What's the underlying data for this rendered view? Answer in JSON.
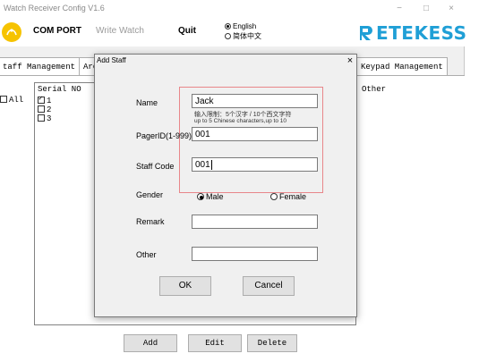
{
  "window": {
    "title": "Watch Receiver Config V1.6",
    "minimize": "−",
    "maximize": "□",
    "close": "×"
  },
  "toolbar": {
    "com_port": "COM PORT",
    "write_watch": "Write Watch",
    "quit": "Quit",
    "lang_english": "English",
    "lang_chinese": "简体中文",
    "selected_language": "English",
    "brand": "ETEKESS",
    "brand_color": "#1f9fd6"
  },
  "tabs": [
    {
      "label": "taff Management"
    },
    {
      "label": "Are"
    },
    {
      "label": "Keypad Management"
    }
  ],
  "staff_list": {
    "all_label": "All",
    "col_serial": "Serial NO",
    "col_other": "Other",
    "rows": [
      {
        "label": "1",
        "checked": true
      },
      {
        "label": "2",
        "checked": false
      },
      {
        "label": "3",
        "checked": false
      }
    ]
  },
  "bottom_buttons": {
    "add": "Add",
    "edit": "Edit",
    "delete": "Delete"
  },
  "dialog": {
    "title": "Add Staff",
    "close": "×",
    "name_label": "Name",
    "name_value": "Jack",
    "hint_cn": "输入限制：5个汉字 / 10个西文字符",
    "hint_en": "up to 5 Chinese characters,up to 10",
    "pager_label": "PagerID(1-999)",
    "pager_value": "001",
    "staff_code_label": "Staff Code",
    "staff_code_value": "001",
    "gender_label": "Gender",
    "gender_male": "Male",
    "gender_female": "Female",
    "gender_selected": "Male",
    "remark_label": "Remark",
    "remark_value": "",
    "other_label": "Other",
    "other_value": "",
    "ok": "OK",
    "cancel": "Cancel"
  }
}
